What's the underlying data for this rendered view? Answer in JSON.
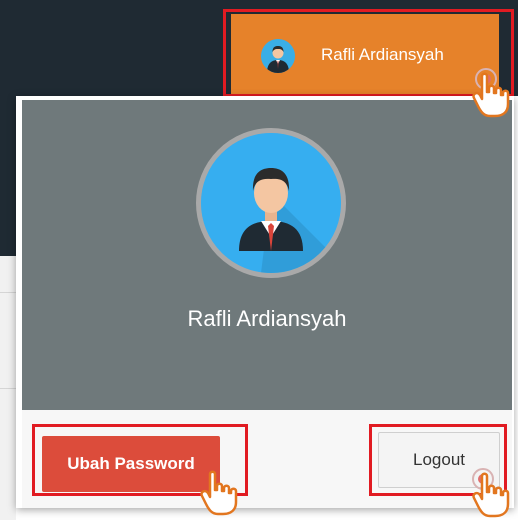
{
  "user": {
    "name": "Rafli Ardiansyah"
  },
  "dropdown": {
    "profile_name": "Rafli Ardiansyah",
    "change_password_label": "Ubah Password",
    "logout_label": "Logout"
  },
  "icons": {
    "user_avatar": "user-avatar-icon",
    "cursor": "hand-pointer-icon"
  },
  "colors": {
    "navbar": "#1f2a33",
    "user_button": "#e6822a",
    "profile_header": "#6f797b",
    "avatar_bg": "#36aef0",
    "danger_button": "#dc4c3b",
    "highlight_outline": "#e11b22"
  }
}
